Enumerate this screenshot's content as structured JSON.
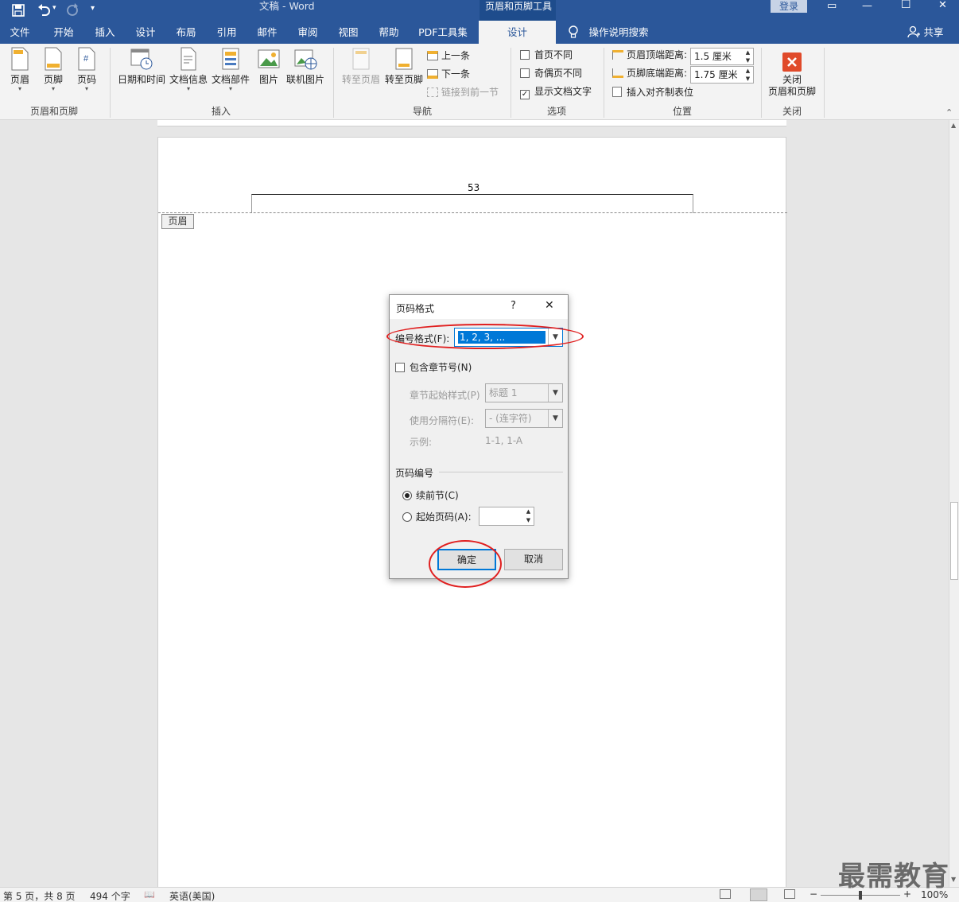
{
  "titlebar": {
    "title": "文稿  -  Word",
    "context_title": "页眉和页脚工具",
    "login": "登录",
    "minimize": "—",
    "maximize": "☐",
    "close": "✕",
    "restore": "▭",
    "qat_more": "▾"
  },
  "tabs": [
    "文件",
    "开始",
    "插入",
    "设计",
    "布局",
    "引用",
    "邮件",
    "审阅",
    "视图",
    "帮助",
    "PDF工具集",
    "设计"
  ],
  "tell_me": "操作说明搜索",
  "share": "共享",
  "ribbon": {
    "header_footer_group": {
      "header": "页眉",
      "footer": "页脚",
      "page_number": "页码",
      "label": "页眉和页脚"
    },
    "insert_group": {
      "datetime": "日期和时间",
      "docinfo": "文档信息",
      "quickparts": "文档部件",
      "picture": "图片",
      "online_picture": "联机图片",
      "label": "插入"
    },
    "navigation_group": {
      "goto_header": "转至页眉",
      "goto_footer": "转至页脚",
      "previous": "上一条",
      "next": "下一条",
      "link_previous": "链接到前一节",
      "label": "导航"
    },
    "options_group": {
      "different_first": "首页不同",
      "different_odd_even": "奇偶页不同",
      "show_doc_text": "显示文档文字",
      "label": "选项"
    },
    "position_group": {
      "header_top_label": "页眉顶端距离:",
      "header_top_value": "1.5 厘米",
      "footer_bottom_label": "页脚底端距离:",
      "footer_bottom_value": "1.75 厘米",
      "insert_align_tab": "插入对齐制表位",
      "label": "位置"
    },
    "close_group": {
      "close_label_1": "关闭",
      "close_label_2": "页眉和页脚",
      "label": "关闭"
    }
  },
  "document": {
    "header_number": "53",
    "header_tag": "页眉"
  },
  "dialog": {
    "title": "页码格式",
    "help": "?",
    "close": "✕",
    "number_format_label": "编号格式(F):",
    "number_format_value": "1, 2, 3, ...",
    "include_chapter_label": "包含章节号(N)",
    "chapter_style_label": "章节起始样式(P)",
    "chapter_style_value": "标题 1",
    "separator_label": "使用分隔符(E):",
    "separator_value": "-   (连字符)",
    "example_label": "示例:",
    "example_value": "1-1, 1-A",
    "page_numbering_label": "页码编号",
    "continue_label": "续前节(C)",
    "start_at_label": "起始页码(A):",
    "start_at_value": "",
    "ok": "确定",
    "cancel": "取消"
  },
  "status": {
    "page": "第 5 页，共 8 页",
    "words": "494 个字",
    "language": "英语(美国)",
    "zoom": "100%",
    "zoom_minus": "−",
    "zoom_plus": "+"
  },
  "watermark": "最需教育",
  "colors": {
    "brand": "#2b579a",
    "highlight": "#0078d7",
    "ring": "#e02020"
  }
}
